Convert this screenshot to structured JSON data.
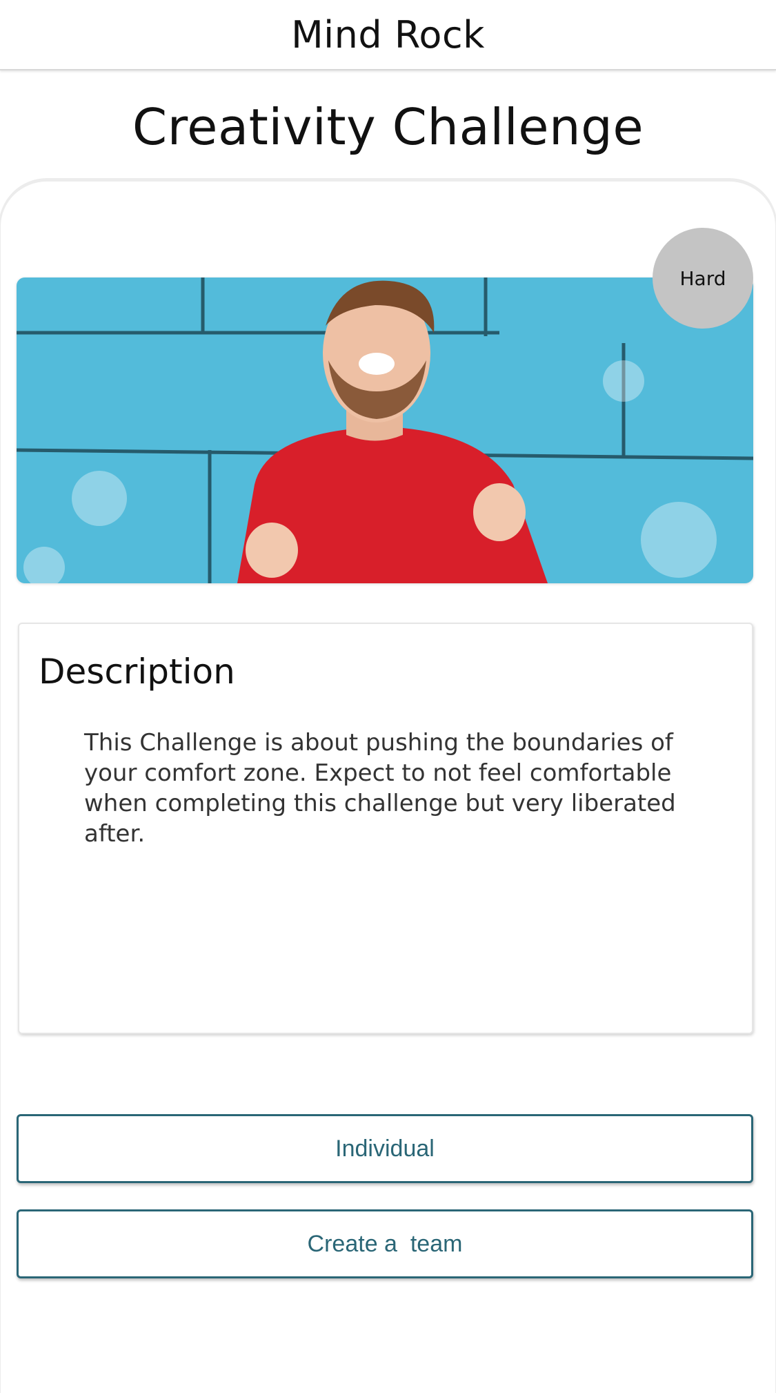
{
  "app_bar": {
    "title": "Mind Rock"
  },
  "page": {
    "title": "Creativity Challenge"
  },
  "challenge": {
    "difficulty": "Hard",
    "image": "man in red sweater cheering against blue brick wall"
  },
  "description": {
    "heading": "Description",
    "text": "This Challenge is about pushing the boundaries of your comfort zone. Expect to not feel comfortable when completing this challenge but very liberated after."
  },
  "actions": {
    "individual_label": "Individual",
    "team_label": "Create a  team"
  },
  "colors": {
    "accent": "#2a6676",
    "badge": "#c4c4c4",
    "wall": "#4bb5d6",
    "sweater": "#d81f2a"
  }
}
